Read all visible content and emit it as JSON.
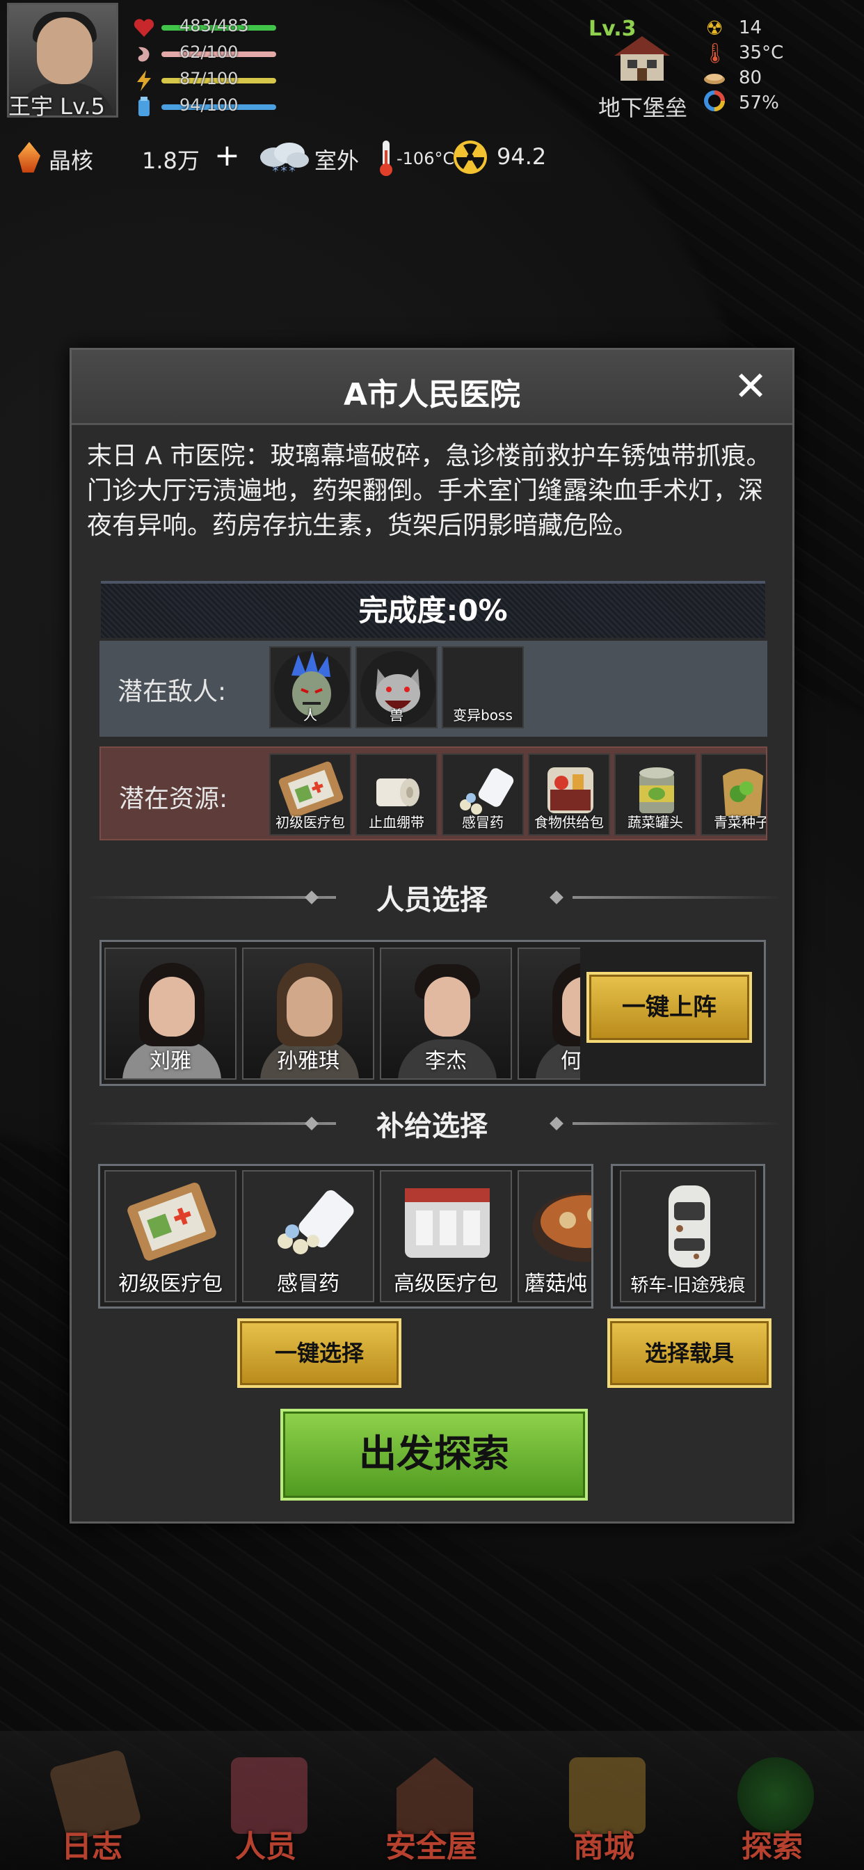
{
  "player": {
    "name": "王宇 Lv.5",
    "stats": [
      {
        "icon": "heart-icon",
        "value": "483/483",
        "color": "#41c44a"
      },
      {
        "icon": "stomach-icon",
        "value": "62/100",
        "color": "#e3a8a8"
      },
      {
        "icon": "energy-icon",
        "value": "87/100",
        "color": "#d6c64a"
      },
      {
        "icon": "water-icon",
        "value": "94/100",
        "color": "#4aa0e0"
      }
    ]
  },
  "base": {
    "level": "Lv.3",
    "name": "地下堡垒",
    "env": [
      {
        "icon": "radiation-icon",
        "value": "14"
      },
      {
        "icon": "thermometer-icon",
        "value": "35°C"
      },
      {
        "icon": "food-icon",
        "value": "80"
      },
      {
        "icon": "percent-gauge-icon",
        "value": "57%"
      }
    ]
  },
  "resources": {
    "crystal_label": "晶核",
    "crystal_amount": "1.8万",
    "plus": "+",
    "weather": "室外",
    "temperature": "-106°C",
    "radiation": "94.2"
  },
  "dialog": {
    "title": "A市人民医院",
    "close": "✕",
    "description": "末日 A 市医院：玻璃幕墙破碎，急诊楼前救护车锈蚀带抓痕。门诊大厅污渍遍地，药架翻倒。手术室门缝露染血手术灯，深夜有异响。药房存抗生素，货架后阴影暗藏危险。",
    "progress": "完成度:0%",
    "enemy_label": "潜在敌人:",
    "enemies": [
      {
        "name": "人"
      },
      {
        "name": "兽"
      },
      {
        "name": "变异boss"
      }
    ],
    "resource_label": "潜在资源:",
    "resources": [
      {
        "name": "初级医疗包"
      },
      {
        "name": "止血绷带"
      },
      {
        "name": "感冒药"
      },
      {
        "name": "食物供给包"
      },
      {
        "name": "蔬菜罐头"
      },
      {
        "name": "青菜种子"
      }
    ],
    "people_title": "人员选择",
    "people": [
      {
        "name": "刘雅"
      },
      {
        "name": "孙雅琪"
      },
      {
        "name": "李杰"
      },
      {
        "name": "何"
      }
    ],
    "deploy_button": "一键上阵",
    "supply_title": "补给选择",
    "supplies": [
      {
        "name": "初级医疗包"
      },
      {
        "name": "感冒药"
      },
      {
        "name": "高级医疗包"
      },
      {
        "name": "蘑菇炖"
      }
    ],
    "vehicle": {
      "name": "轿车-旧途残痕"
    },
    "select_all_button": "一键选择",
    "select_vehicle_button": "选择载具",
    "explore_button": "出发探索"
  },
  "nav": [
    {
      "label": "日志"
    },
    {
      "label": "人员"
    },
    {
      "label": "安全屋"
    },
    {
      "label": "商城"
    },
    {
      "label": "探索"
    }
  ]
}
